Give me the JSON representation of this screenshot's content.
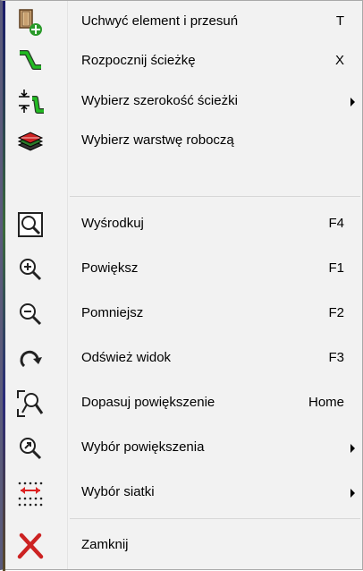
{
  "menu": {
    "items": [
      {
        "label": "Uchwyć element i przesuń",
        "shortcut": "T",
        "icon": "grab-move-icon"
      },
      {
        "label": "Rozpocznij ścieżkę",
        "shortcut": "X",
        "icon": "route-track-icon"
      },
      {
        "label": "Wybierz szerokość ścieżki",
        "shortcut": "",
        "icon": "track-width-icon",
        "submenu": true
      },
      {
        "label": "Wybierz warstwę roboczą",
        "shortcut": "",
        "icon": "layers-icon"
      },
      {
        "label": "Wyśrodkuj",
        "shortcut": "F4",
        "icon": "zoom-center-icon"
      },
      {
        "label": "Powiększ",
        "shortcut": "F1",
        "icon": "zoom-in-icon"
      },
      {
        "label": "Pomniejsz",
        "shortcut": "F2",
        "icon": "zoom-out-icon"
      },
      {
        "label": "Odśwież widok",
        "shortcut": "F3",
        "icon": "refresh-icon"
      },
      {
        "label": "Dopasuj powiększenie",
        "shortcut": "Home",
        "icon": "zoom-fit-icon"
      },
      {
        "label": "Wybór powiększenia",
        "shortcut": "",
        "icon": "zoom-select-icon",
        "submenu": true
      },
      {
        "label": "Wybór siatki",
        "shortcut": "",
        "icon": "grid-select-icon",
        "submenu": true
      },
      {
        "label": "Zamknij",
        "shortcut": "",
        "icon": "close-icon"
      }
    ]
  },
  "colors": {
    "menu_background": "#f2f2f2",
    "separator": "#d7d7d7",
    "track_green": "#22aa22",
    "close_red": "#cc2222",
    "grid_red": "#dd2222"
  }
}
